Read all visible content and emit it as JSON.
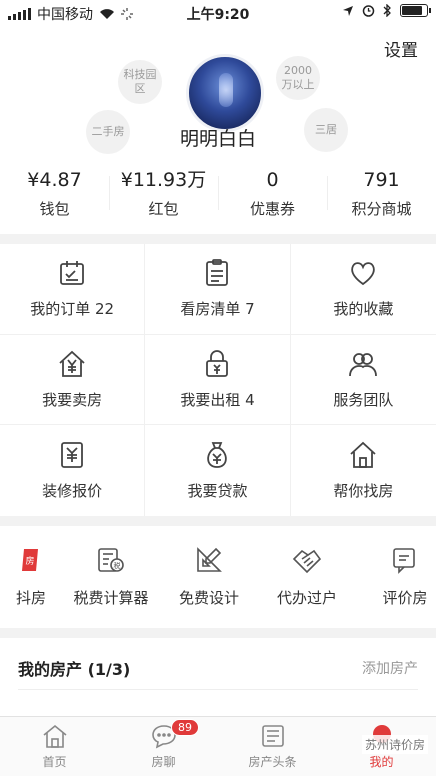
{
  "status_bar": {
    "carrier": "中国移动",
    "time": "上午9:20"
  },
  "profile": {
    "settings_label": "设置",
    "username": "明明白白",
    "tags": [
      "科技园区",
      "2000万以上",
      "二手房",
      "三居"
    ]
  },
  "stats": [
    {
      "value": "¥4.87",
      "label": "钱包"
    },
    {
      "value": "¥11.93万",
      "label": "红包"
    },
    {
      "value": "0",
      "label": "优惠券"
    },
    {
      "value": "791",
      "label": "积分商城"
    }
  ],
  "grid": [
    {
      "label": "我的订单 22",
      "icon": "order-icon"
    },
    {
      "label": "看房清单 7",
      "icon": "list-icon"
    },
    {
      "label": "我的收藏",
      "icon": "heart-icon"
    },
    {
      "label": "我要卖房",
      "icon": "house-yen-icon"
    },
    {
      "label": "我要出租 4",
      "icon": "lock-house-icon"
    },
    {
      "label": "服务团队",
      "icon": "team-icon"
    },
    {
      "label": "装修报价",
      "icon": "quote-icon"
    },
    {
      "label": "我要贷款",
      "icon": "money-bag-icon"
    },
    {
      "label": "帮你找房",
      "icon": "home-icon"
    }
  ],
  "tools": [
    {
      "label": "抖房",
      "icon": "doufang-icon"
    },
    {
      "label": "税费计算器",
      "icon": "calculator-icon"
    },
    {
      "label": "免费设计",
      "icon": "design-icon"
    },
    {
      "label": "代办过户",
      "icon": "handshake-icon"
    },
    {
      "label": "评价房",
      "icon": "review-icon"
    }
  ],
  "property": {
    "title": "我的房产 (1/3)",
    "action": "添加房产"
  },
  "tabbar": [
    {
      "label": "首页",
      "icon": "home-tab-icon"
    },
    {
      "label": "房聊",
      "icon": "chat-icon",
      "badge": "89"
    },
    {
      "label": "房产头条",
      "icon": "news-icon"
    },
    {
      "label": "我的",
      "icon": "profile-icon"
    }
  ],
  "watermark": "苏州诗价房",
  "colors": {
    "accent": "#e03a3a",
    "separator": "#f2f2f2"
  }
}
